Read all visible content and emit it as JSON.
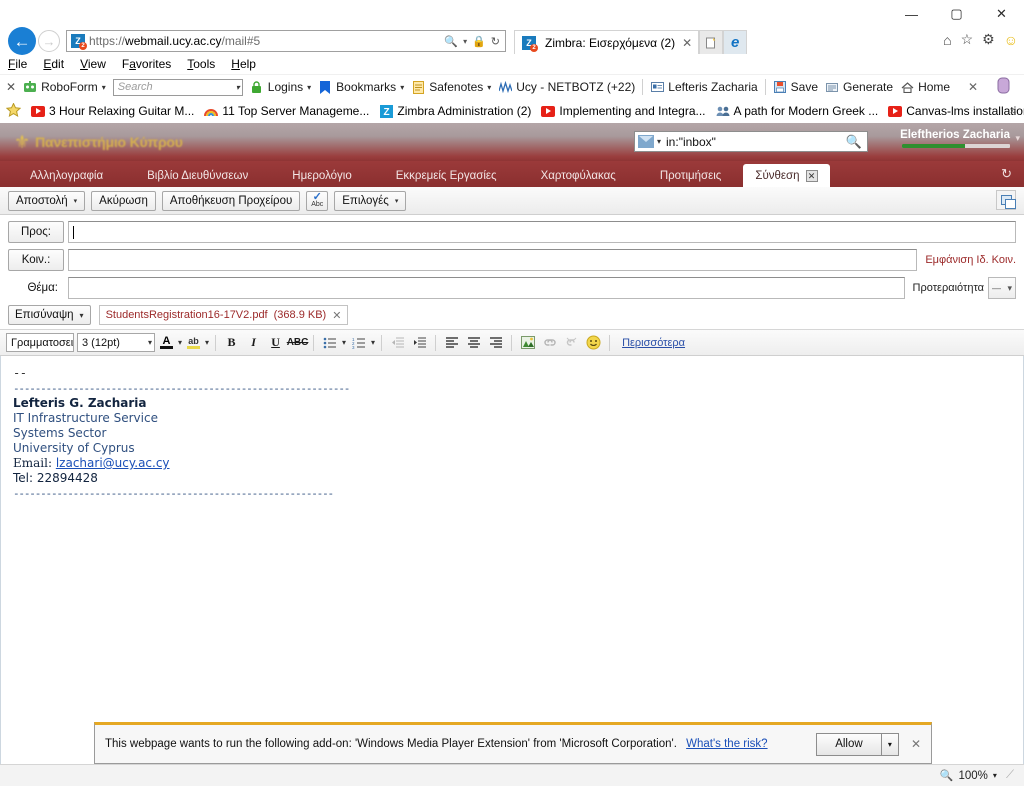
{
  "browser": {
    "window_controls": {
      "minimize": "—",
      "maximize": "▢",
      "close": "✕"
    },
    "back_icon": "back-arrow-icon",
    "forward_icon": "forward-arrow-icon",
    "address": {
      "scheme": "https://",
      "host_pre": "webmail.",
      "host_bold": "ucy.ac.cy",
      "path": "/mail#5",
      "full": "https://webmail.ucy.ac.cy/mail#5"
    },
    "address_icons": {
      "search": "🔍",
      "dropdown": "▾",
      "lock": "🔒",
      "refresh": "↻"
    },
    "tab": {
      "label": "Zimbra: Εισερχόμενα (2)",
      "close": "✕"
    },
    "new_tab": "✛",
    "ie_button": "e",
    "right_icons": {
      "home": "⌂",
      "favorites": "☆",
      "tools": "⚙",
      "smiley": "☺"
    },
    "menu": [
      {
        "label": "File",
        "accel": "F"
      },
      {
        "label": "Edit",
        "accel": "E"
      },
      {
        "label": "View",
        "accel": "V"
      },
      {
        "label": "Favorites",
        "accel": "a"
      },
      {
        "label": "Tools",
        "accel": "T"
      },
      {
        "label": "Help",
        "accel": "H"
      }
    ],
    "roboform": {
      "close": "✕",
      "title": "RoboForm",
      "search_placeholder": "Search",
      "logins": "Logins",
      "bookmarks": "Bookmarks",
      "safenotes": "Safenotes",
      "netbotz": "Ucy - NETBOTZ (+22)",
      "identity": "Lefteris Zacharia",
      "save": "Save",
      "generate": "Generate",
      "home": "Home",
      "row_close": "✕"
    },
    "bookmarks": [
      {
        "label": "3 Hour Relaxing Guitar M...",
        "icon": "youtube-icon"
      },
      {
        "label": "11 Top Server Manageme...",
        "icon": "rainbow-icon"
      },
      {
        "label": "Zimbra Administration (2)",
        "icon": "zimbra-icon"
      },
      {
        "label": "Implementing and Integra...",
        "icon": "youtube-icon"
      },
      {
        "label": "A path for Modern Greek ...",
        "icon": "people-icon"
      },
      {
        "label": "Canvas-lms installation - ...",
        "icon": "youtube-icon"
      }
    ],
    "bookmarks_overflow": "»",
    "favorites_star": "⭐"
  },
  "zimbra": {
    "logo_text": "Πανεπιστήμιο Κύπρου",
    "search": {
      "value": "in:\"inbox\"",
      "go_icon": "search-icon",
      "type_icon": "mail-icon",
      "caret": "▾"
    },
    "user": {
      "name": "Eleftherios Zacharia",
      "caret": "▾",
      "quota_percent": 58
    },
    "nav_tabs": [
      {
        "label": "Αλληλογραφία",
        "active": false
      },
      {
        "label": "Βιβλίο Διευθύνσεων",
        "active": false
      },
      {
        "label": "Ημερολόγιο",
        "active": false
      },
      {
        "label": "Εκκρεμείς Εργασίες",
        "active": false
      },
      {
        "label": "Χαρτοφύλακας",
        "active": false
      },
      {
        "label": "Προτιμήσεις",
        "active": false
      },
      {
        "label": "Σύνθεση",
        "active": true,
        "close": "✕"
      }
    ],
    "refresh_icon": "↻"
  },
  "compose": {
    "toolbar": {
      "send": "Αποστολή",
      "cancel": "Ακύρωση",
      "save_draft": "Αποθήκευση Προχείρου",
      "spellcheck_label": "Abc",
      "options": "Επιλογές",
      "caret": "▾",
      "detach_icon": "detach-window-icon"
    },
    "fields": {
      "to_label": "Προς:",
      "to_value": "",
      "cc_label": "Κοιν.:",
      "cc_value": "",
      "show_bcc": "Εμφάνιση Ιδ. Κοιν.",
      "subject_label": "Θέμα:",
      "subject_value": "",
      "priority_label": "Προτεραιότητα",
      "priority_value": "—",
      "priority_caret": "▾"
    },
    "attachments": {
      "button": "Επισύναψη",
      "caret": "▾",
      "items": [
        {
          "name": "StudentsRegistration16-17V2.pdf",
          "size": "(368.9 KB)",
          "remove": "✕"
        }
      ]
    },
    "format_toolbar": {
      "font_family": "Γραμματοσειρ",
      "font_size": "3 (12pt)",
      "text_color": "A",
      "highlight": "ab",
      "bold": "B",
      "italic": "I",
      "underline": "U",
      "strikethrough": "ABC",
      "bullet_list": "☰",
      "number_list": "☰",
      "outdent": "⇤",
      "indent": "⇥",
      "align_left": "≡",
      "align_center": "≡",
      "align_right": "≡",
      "insert_image": "🖼",
      "insert_link": "🔗",
      "remove_link": "⛓",
      "emoticon": "☺",
      "more": "Περισσότερα",
      "caret": "▾"
    },
    "signature": {
      "dashes": "--",
      "rule_top": "--------------------------------------------------------------",
      "name": "Lefteris G. Zacharia",
      "line1": "IT Infrastructure Service",
      "line2": "Systems Sector",
      "line3": "University of Cyprus",
      "email_label": "Email:",
      "email": "lzachari@ucy.ac.cy",
      "tel": "Tel: 22894428",
      "rule_bottom": "-----------------------------------------------------------"
    }
  },
  "notification": {
    "text": "This webpage wants to run the following add-on: 'Windows Media Player Extension' from 'Microsoft Corporation'.",
    "risk_link": "What's the risk?",
    "allow": "Allow",
    "allow_caret": "▾",
    "close": "✕"
  },
  "statusbar": {
    "zoom_icon": "zoom-icon",
    "zoom": "100%",
    "zoom_caret": "▾"
  }
}
